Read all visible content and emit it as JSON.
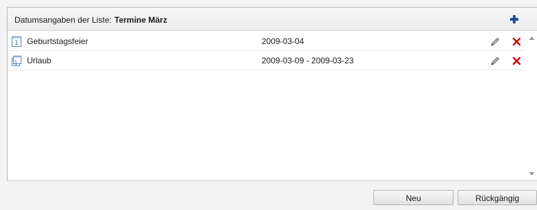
{
  "header": {
    "label": "Datumsangaben der Liste:",
    "list_name": "Termine März",
    "add_icon": "plus-icon"
  },
  "rows": [
    {
      "name": "Geburtstagsfeier",
      "date": "2009-03-04",
      "icon": "calendar-day-icon"
    },
    {
      "name": "Urlaub",
      "date": "2009-03-09 - 2009-03-23",
      "icon": "calendar-range-icon"
    }
  ],
  "row_actions": {
    "edit_icon": "pencil-icon",
    "delete_icon": "close-icon"
  },
  "buttons": {
    "new_label": "Neu",
    "undo_label": "Rückgängig"
  },
  "colors": {
    "add_icon": "#1f4e96",
    "delete_icon": "#d00000",
    "calendar_icon": "#3a6db5"
  }
}
